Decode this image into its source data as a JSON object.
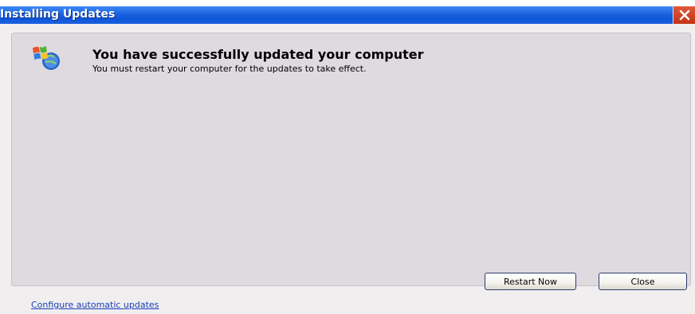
{
  "window": {
    "title": "Installing Updates",
    "close_icon": "close-icon"
  },
  "message": {
    "icon": "windows-update-icon",
    "heading": "You have successfully updated your computer",
    "subtext": "You must restart your computer for the updates to take effect."
  },
  "footer": {
    "link_label": "Configure automatic updates",
    "restart_label": "Restart Now",
    "close_label": "Close"
  },
  "colors": {
    "titlebar": "#1f66e0",
    "close_button": "#d4431f",
    "link": "#1a3fb8",
    "panel": "#dedadf"
  }
}
